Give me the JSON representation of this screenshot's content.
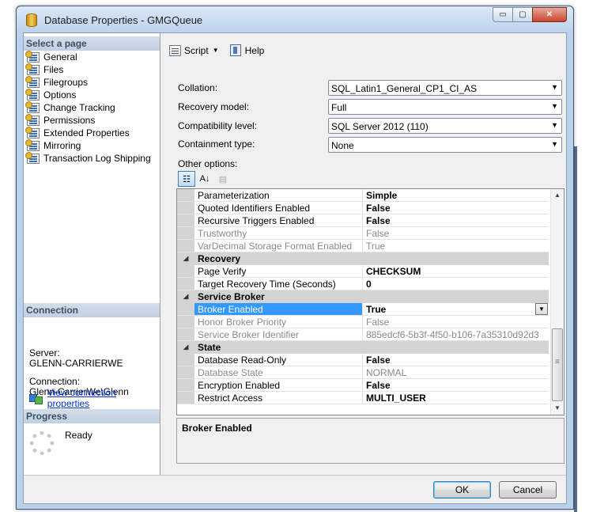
{
  "window": {
    "title": "Database Properties - GMGQueue",
    "controls": {
      "minimize": "▭",
      "maximize": "▢",
      "close": "✕"
    }
  },
  "sidebar": {
    "select_page_header": "Select a page",
    "pages": [
      {
        "label": "General"
      },
      {
        "label": "Files"
      },
      {
        "label": "Filegroups"
      },
      {
        "label": "Options"
      },
      {
        "label": "Change Tracking"
      },
      {
        "label": "Permissions"
      },
      {
        "label": "Extended Properties"
      },
      {
        "label": "Mirroring"
      },
      {
        "label": "Transaction Log Shipping"
      }
    ],
    "connection": {
      "header": "Connection",
      "server_label": "Server:",
      "server_value": "GLENN-CARRIERWE",
      "connection_label": "Connection:",
      "connection_value": "Glenn-CarrierWe\\Glenn",
      "view_link": "View connection properties"
    },
    "progress": {
      "header": "Progress",
      "status": "Ready"
    }
  },
  "toolbar": {
    "script_label": "Script",
    "dropdown_arrow": "▼",
    "help_label": "Help"
  },
  "form": {
    "collation": {
      "label": "Collation:",
      "value": "SQL_Latin1_General_CP1_CI_AS"
    },
    "recovery_model": {
      "label": "Recovery model:",
      "value": "Full"
    },
    "compatibility_level": {
      "label": "Compatibility level:",
      "value": "SQL Server 2012 (110)"
    },
    "containment_type": {
      "label": "Containment type:",
      "value": "None"
    },
    "other_options_label": "Other options:",
    "combo_arrow": "▼"
  },
  "grid_tools": {
    "categorized": "☷",
    "alphabetical": "A↓",
    "property_pages": "▤"
  },
  "grid": {
    "expand_glyph": "◢",
    "rows": [
      {
        "type": "prop",
        "name": "Parameterization",
        "value": "Simple",
        "bold": true
      },
      {
        "type": "prop",
        "name": "Quoted Identifiers Enabled",
        "value": "False",
        "bold": true
      },
      {
        "type": "prop",
        "name": "Recursive Triggers Enabled",
        "value": "False",
        "bold": true
      },
      {
        "type": "prop",
        "name": "Trustworthy",
        "value": "False",
        "disabled": true
      },
      {
        "type": "prop",
        "name": "VarDecimal Storage Format Enabled",
        "value": "True",
        "disabled": true
      },
      {
        "type": "cat",
        "name": "Recovery"
      },
      {
        "type": "prop",
        "name": "Page Verify",
        "value": "CHECKSUM",
        "bold": true
      },
      {
        "type": "prop",
        "name": "Target Recovery Time (Seconds)",
        "value": "0",
        "bold": true
      },
      {
        "type": "cat",
        "name": "Service Broker"
      },
      {
        "type": "prop",
        "name": "Broker Enabled",
        "value": "True",
        "bold": true,
        "selected": true
      },
      {
        "type": "prop",
        "name": "Honor Broker Priority",
        "value": "False",
        "disabled": true
      },
      {
        "type": "prop",
        "name": "Service Broker Identifier",
        "value": "885edcf6-5b3f-4f50-b106-7a35310d92d3",
        "disabled": true
      },
      {
        "type": "cat",
        "name": "State"
      },
      {
        "type": "prop",
        "name": "Database Read-Only",
        "value": "False",
        "bold": true
      },
      {
        "type": "prop",
        "name": "Database State",
        "value": "NORMAL",
        "disabled": true
      },
      {
        "type": "prop",
        "name": "Encryption Enabled",
        "value": "False",
        "bold": true
      },
      {
        "type": "prop",
        "name": "Restrict Access",
        "value": "MULTI_USER",
        "bold": true
      }
    ],
    "scroll_up": "▲",
    "scroll_down": "▼"
  },
  "description": {
    "title": "Broker Enabled"
  },
  "buttons": {
    "ok": "OK",
    "cancel": "Cancel"
  }
}
